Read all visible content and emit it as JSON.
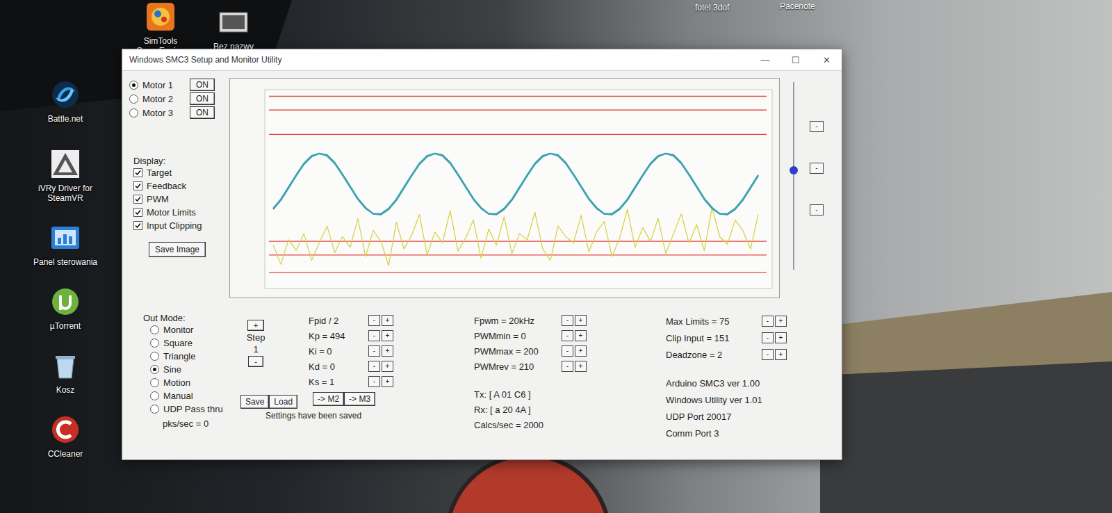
{
  "desktop": {
    "icons": [
      {
        "label": "SimTools GameEngine",
        "kind": "simtools"
      },
      {
        "label": "Bez nazwy",
        "kind": "image"
      },
      {
        "label": "Battle.net",
        "kind": "battlenet"
      },
      {
        "label": "iVRy Driver for SteamVR",
        "kind": "ivry"
      },
      {
        "label": "Panel sterowania",
        "kind": "controlpanel"
      },
      {
        "label": "µTorrent",
        "kind": "utorrent"
      },
      {
        "label": "Kosz",
        "kind": "recyclebin"
      },
      {
        "label": "CCleaner",
        "kind": "ccleaner"
      }
    ],
    "top_labels": [
      "fotel 3dof",
      "Pacenote"
    ]
  },
  "window": {
    "title": "Windows SMC3 Setup and Monitor Utility",
    "controls": [
      "—",
      "☐",
      "✕"
    ]
  },
  "motors": [
    {
      "label": "Motor 1",
      "button": "ON",
      "selected": true
    },
    {
      "label": "Motor 2",
      "button": "ON",
      "selected": false
    },
    {
      "label": "Motor 3",
      "button": "ON",
      "selected": false
    }
  ],
  "display": {
    "label": "Display:",
    "options": [
      {
        "label": "Target",
        "checked": true
      },
      {
        "label": "Feedback",
        "checked": true
      },
      {
        "label": "PWM",
        "checked": true
      },
      {
        "label": "Motor Limits",
        "checked": true
      },
      {
        "label": "Input Clipping",
        "checked": true
      }
    ]
  },
  "save_image": "Save Image",
  "chart": {
    "series": [
      {
        "name": "PWM",
        "color": "#d6cf3e",
        "values": [
          55,
          30,
          62,
          48,
          70,
          35,
          58,
          80,
          45,
          66,
          52,
          90,
          40,
          74,
          60,
          28,
          85,
          50,
          68,
          95,
          42,
          72,
          58,
          100,
          47,
          64,
          88,
          38,
          76,
          55,
          92,
          44,
          70,
          62,
          98,
          50,
          35,
          80,
          66,
          58,
          94,
          46,
          72,
          86,
          40,
          64,
          102,
          52,
          78,
          60,
          90,
          44,
          70,
          96,
          58,
          82,
          48,
          104,
          66,
          56,
          88,
          74,
          50,
          95
        ]
      },
      {
        "name": "Feedback",
        "color": "#3b9a5e",
        "values": [
          102,
          114,
          130,
          146,
          161,
          171,
          175,
          173,
          163,
          148,
          132,
          116,
          104,
          96,
          95,
          102,
          114,
          130,
          146,
          161,
          171,
          175,
          173,
          163,
          148,
          132,
          116,
          104,
          96,
          95,
          102,
          114,
          130,
          146,
          161,
          171,
          175,
          173,
          163,
          148,
          132,
          116,
          104,
          96,
          95,
          102,
          114,
          130,
          146,
          161,
          171,
          175,
          173,
          163,
          148,
          132,
          116,
          104,
          96,
          95,
          102,
          114,
          130,
          146
        ]
      },
      {
        "name": "Target",
        "color": "#3aa3c6",
        "values": [
          103,
          115,
          131,
          147,
          162,
          172,
          175,
          172,
          162,
          147,
          131,
          115,
          103,
          96,
          96,
          103,
          115,
          131,
          147,
          162,
          172,
          175,
          172,
          162,
          147,
          131,
          115,
          103,
          96,
          96,
          103,
          115,
          131,
          147,
          162,
          172,
          175,
          172,
          162,
          147,
          131,
          115,
          103,
          96,
          96,
          103,
          115,
          131,
          147,
          162,
          172,
          175,
          172,
          162,
          147,
          131,
          115,
          103,
          96,
          96,
          103,
          115,
          131,
          147
        ]
      }
    ],
    "limit_lines": [
      {
        "value": 250
      },
      {
        "value": 232
      },
      {
        "value": 200
      },
      {
        "value": 60
      },
      {
        "value": 42
      },
      {
        "value": 19
      }
    ]
  },
  "slider": {
    "level": 0.53
  },
  "side_buttons": [
    "-",
    "-",
    "-"
  ],
  "out_mode": {
    "label": "Out Mode:",
    "options": [
      {
        "label": "Monitor",
        "selected": false
      },
      {
        "label": "Square",
        "selected": false
      },
      {
        "label": "Triangle",
        "selected": false
      },
      {
        "label": "Sine",
        "selected": true
      },
      {
        "label": "Motion",
        "selected": false
      },
      {
        "label": "Manual",
        "selected": false
      },
      {
        "label": "UDP Pass thru",
        "selected": false
      }
    ],
    "pks": "pks/sec = 0"
  },
  "step": {
    "plus": "+",
    "label": "Step",
    "value": "1",
    "minus": "-"
  },
  "pid": [
    {
      "label": "Fpid / 2",
      "minus": "-",
      "plus": "+"
    },
    {
      "label": "Kp = 494",
      "minus": "-",
      "plus": "+"
    },
    {
      "label": "Ki = 0",
      "minus": "-",
      "plus": "+"
    },
    {
      "label": "Kd = 0",
      "minus": "-",
      "plus": "+"
    },
    {
      "label": "Ks = 1",
      "minus": "-",
      "plus": "+"
    }
  ],
  "pwm": [
    {
      "label": "Fpwm = 20kHz",
      "minus": "-",
      "plus": "+"
    },
    {
      "label": "PWMmin = 0",
      "minus": "-",
      "plus": "+"
    },
    {
      "label": "PWMmax = 200",
      "minus": "-",
      "plus": "+"
    },
    {
      "label": "PWMrev = 210",
      "minus": "-",
      "plus": "+"
    }
  ],
  "comm": [
    "Tx: [ A 01 C6 ]",
    "Rx: [ a 20 4A ]",
    "Calcs/sec = 2000"
  ],
  "limits": [
    {
      "label": "Max Limits = 75",
      "minus": "-",
      "plus": "+"
    },
    {
      "label": "Clip Input = 151",
      "minus": "-",
      "plus": "+"
    },
    {
      "label": "Deadzone = 2",
      "minus": "-",
      "plus": "+"
    }
  ],
  "info": [
    "Arduino SMC3 ver 1.00",
    "Windows Utility ver 1.01",
    "UDP Port 20017",
    "Comm Port 3"
  ],
  "file_buttons": [
    "Save",
    "Load"
  ],
  "copy_buttons": [
    "-> M2",
    "-> M3"
  ],
  "status": "Settings have been saved"
}
